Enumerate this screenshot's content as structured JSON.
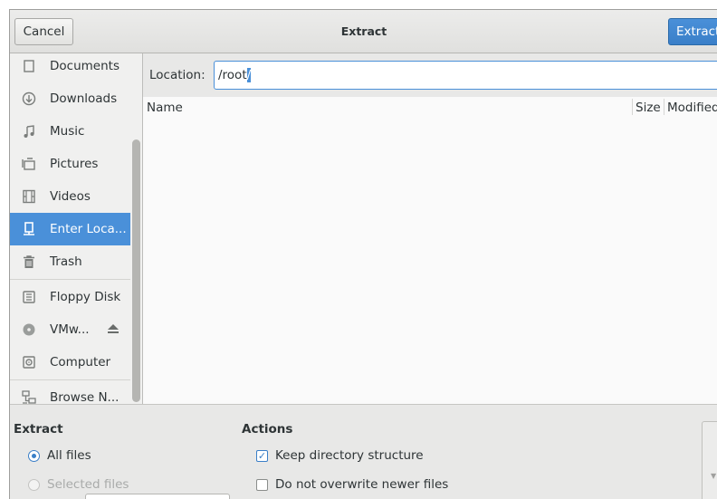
{
  "header": {
    "cancel_label": "Cancel",
    "title": "Extract",
    "extract_label": "Extract"
  },
  "sidebar": {
    "items": [
      {
        "label": "Documents",
        "icon": "document-icon"
      },
      {
        "label": "Downloads",
        "icon": "download-icon"
      },
      {
        "label": "Music",
        "icon": "music-icon"
      },
      {
        "label": "Pictures",
        "icon": "pictures-icon"
      },
      {
        "label": "Videos",
        "icon": "video-icon"
      },
      {
        "label": "Enter Loca...",
        "icon": "location-icon",
        "selected": true
      },
      {
        "label": "Trash",
        "icon": "trash-icon"
      },
      {
        "label": "Floppy Disk",
        "icon": "floppy-icon"
      },
      {
        "label": "VMw...",
        "icon": "disc-icon"
      },
      {
        "label": "Computer",
        "icon": "computer-icon"
      },
      {
        "label": "Browse N...",
        "icon": "network-icon"
      }
    ]
  },
  "location": {
    "label": "Location:",
    "value": "/root",
    "selected_part": "/"
  },
  "columns": {
    "name": "Name",
    "size": "Size",
    "modified": "Modified"
  },
  "extract_section": {
    "title": "Extract",
    "all_files": "All files",
    "selected_files": "Selected files"
  },
  "actions_section": {
    "title": "Actions",
    "keep_structure": "Keep directory structure",
    "no_overwrite": "Do not overwrite newer files"
  },
  "colors": {
    "accent": "#4a90d9",
    "background": "#e8e8e7"
  }
}
